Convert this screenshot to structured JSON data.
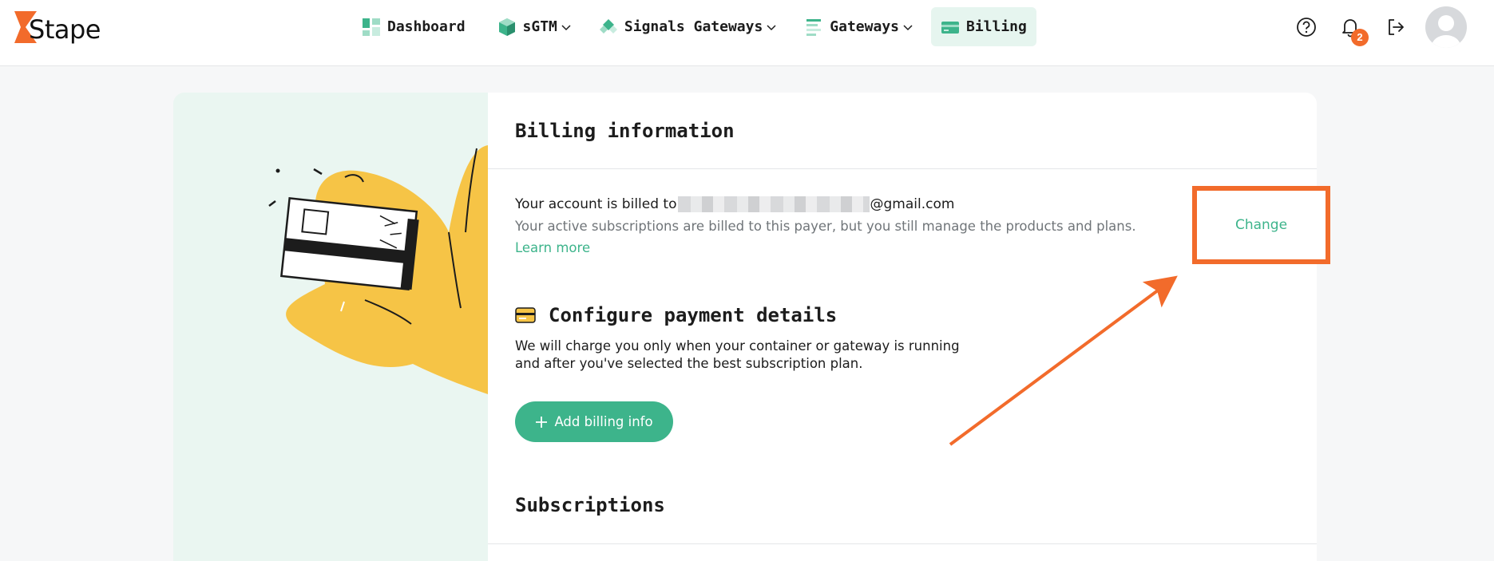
{
  "app": {
    "logo_text": "Stape",
    "brand_color": "#f26b2b",
    "accent_color": "#3db48b"
  },
  "nav": {
    "dashboard": "Dashboard",
    "sgtm": "sGTM",
    "signals": "Signals Gateways",
    "gateways": "Gateways",
    "billing": "Billing"
  },
  "header": {
    "help_icon": "help-circle-icon",
    "notifications_icon": "bell-icon",
    "notifications_count": "2",
    "logout_icon": "logout-icon"
  },
  "billing_info": {
    "title": "Billing information",
    "billed_prefix": "Your account is billed to",
    "billed_email_suffix": "@gmail.com",
    "description": "Your active subscriptions are billed to this payer, but you still manage the products and plans.",
    "learn_more": "Learn more",
    "change_label": "Change"
  },
  "payment": {
    "title": "Configure payment details",
    "desc_line1": "We will charge you only when your container or gateway is running",
    "desc_line2": "and after you've selected the best subscription plan.",
    "add_button": "Add billing info"
  },
  "subscriptions": {
    "title": "Subscriptions"
  }
}
